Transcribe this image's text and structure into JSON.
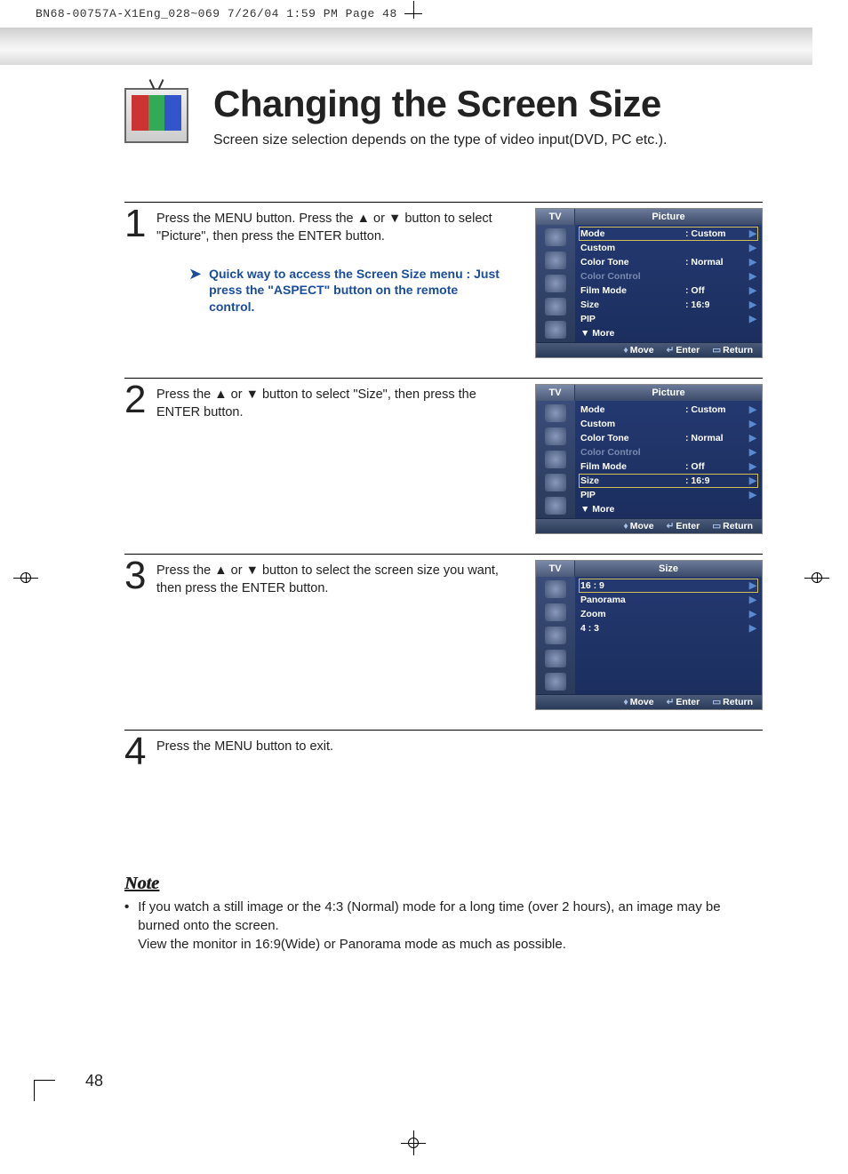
{
  "print_header": "BN68-00757A-X1Eng_028~069  7/26/04  1:59 PM  Page 48",
  "title": "Changing the Screen Size",
  "subtitle": "Screen size selection depends on the type of video input(DVD, PC etc.).",
  "steps": [
    {
      "num": "1",
      "text": "Press the MENU button. Press the ▲ or ▼ button to select \"Picture\", then press the ENTER button."
    },
    {
      "num": "2",
      "text": "Press the ▲ or ▼ button to select \"Size\", then press the ENTER button."
    },
    {
      "num": "3",
      "text": "Press the ▲ or ▼ button to select the screen size you want, then press the ENTER button."
    },
    {
      "num": "4",
      "text": "Press the MENU button to exit."
    }
  ],
  "tip": "Quick way to access the Screen Size menu : Just press the \"ASPECT\" button on the remote control.",
  "osd1": {
    "tv": "TV",
    "title": "Picture",
    "items": [
      {
        "lbl": "Mode",
        "val": ":  Custom",
        "hl": true
      },
      {
        "lbl": "Custom",
        "val": ""
      },
      {
        "lbl": "Color Tone",
        "val": ":  Normal"
      },
      {
        "lbl": "Color Control",
        "val": "",
        "dim": true
      },
      {
        "lbl": "Film Mode",
        "val": ":  Off"
      },
      {
        "lbl": "Size",
        "val": ":  16:9"
      },
      {
        "lbl": "PIP",
        "val": ""
      },
      {
        "lbl": "▼ More",
        "val": "",
        "noarr": true
      }
    ],
    "footer": {
      "move": "Move",
      "enter": "Enter",
      "ret": "Return"
    }
  },
  "osd2": {
    "tv": "TV",
    "title": "Picture",
    "items": [
      {
        "lbl": "Mode",
        "val": ":  Custom"
      },
      {
        "lbl": "Custom",
        "val": ""
      },
      {
        "lbl": "Color Tone",
        "val": ":  Normal"
      },
      {
        "lbl": "Color Control",
        "val": "",
        "dim": true
      },
      {
        "lbl": "Film Mode",
        "val": ":  Off"
      },
      {
        "lbl": "Size",
        "val": ":  16:9",
        "hl": true
      },
      {
        "lbl": "PIP",
        "val": ""
      },
      {
        "lbl": "▼ More",
        "val": "",
        "noarr": true
      }
    ],
    "footer": {
      "move": "Move",
      "enter": "Enter",
      "ret": "Return"
    }
  },
  "osd3": {
    "tv": "TV",
    "title": "Size",
    "items": [
      {
        "lbl": "16 : 9",
        "hl": true
      },
      {
        "lbl": "Panorama"
      },
      {
        "lbl": "Zoom"
      },
      {
        "lbl": "4 : 3"
      }
    ],
    "footer": {
      "move": "Move",
      "enter": "Enter",
      "ret": "Return"
    }
  },
  "note_heading": "Note",
  "note_text": "If you watch a still image or the 4:3 (Normal) mode for a long time (over 2 hours), an image may be burned onto the screen.\nView the monitor in 16:9(Wide) or Panorama mode as much as possible.",
  "page_num": "48"
}
